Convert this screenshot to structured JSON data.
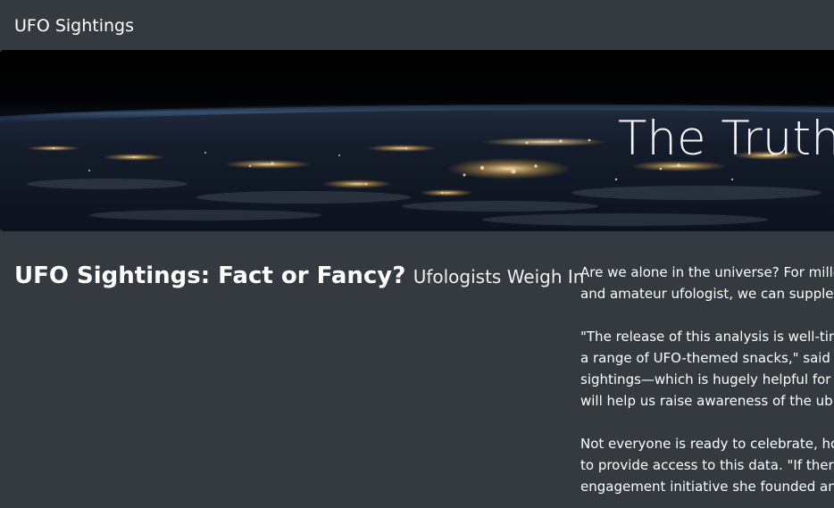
{
  "navbar": {
    "brand": "UFO Sightings"
  },
  "hero": {
    "title": "The Truth I",
    "image": "earth-at-night-from-orbit"
  },
  "headline": {
    "main": "UFO Sightings: Fact or Fancy?",
    "sub": "Ufologists Weigh In"
  },
  "article": {
    "paragraphs": [
      {
        "lines": [
          "Are we alone in the universe? For millenn",
          "and amateur ufologist, we can suppleme"
        ]
      },
      {
        "lines": [
          "\"The release of this analysis is well-timed",
          "a range of UFO-themed snacks,\" said Dr.",
          "sightings—which is hugely helpful for us",
          "will help us raise awareness of the ubiqu"
        ]
      },
      {
        "lines": [
          "Not everyone is ready to celebrate, howe",
          "to provide access to this data. \"If there a",
          "engagement initiative she founded and f"
        ]
      }
    ]
  },
  "colors": {
    "background": "#343a40",
    "text": "#ffffff"
  }
}
